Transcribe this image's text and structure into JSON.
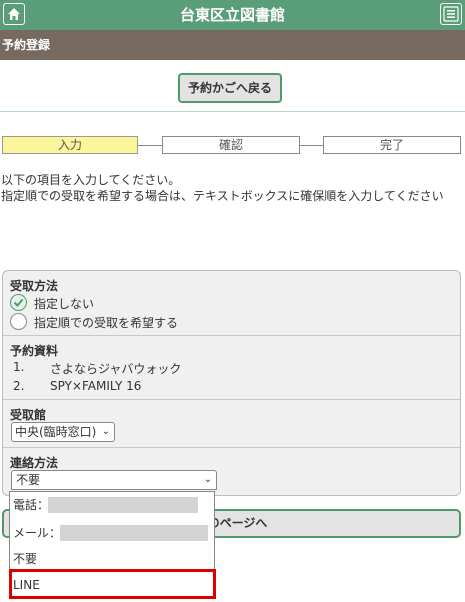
{
  "header": {
    "title": "台東区立図書館",
    "home_icon": "home-icon",
    "menu_icon": "menu-icon",
    "brand_color": "#5a9e79"
  },
  "subheader": {
    "title": "予約登録"
  },
  "back_button": {
    "label": "予約かごへ戻る"
  },
  "steps": [
    {
      "label": "入力",
      "active": true
    },
    {
      "label": "確認",
      "active": false
    },
    {
      "label": "完了",
      "active": false
    }
  ],
  "instructions": [
    "以下の項目を入力してください。",
    "指定順での受取を希望する場合は、テキストボックスに確保順を入力してください"
  ],
  "form": {
    "pickup_method": {
      "title": "受取方法",
      "options": [
        {
          "label": "指定しない",
          "checked": true
        },
        {
          "label": "指定順での受取を希望する",
          "checked": false
        }
      ]
    },
    "reserved_items": {
      "title": "予約資料",
      "items": [
        {
          "num": "1.",
          "title": "さよならジャバウォック"
        },
        {
          "num": "2.",
          "title": "SPY×FAMILY 16"
        }
      ]
    },
    "pickup_library": {
      "title": "受取館",
      "selected": "中央(臨時窓口)"
    },
    "contact_method": {
      "title": "連絡方法",
      "selected": "不要",
      "options": [
        "電話：",
        "メール：",
        "不要",
        "LINE"
      ]
    }
  },
  "next_button": {
    "label": "次のページへ"
  },
  "colors": {
    "step_active": "#fdf59b",
    "highlight": "#e00000"
  }
}
